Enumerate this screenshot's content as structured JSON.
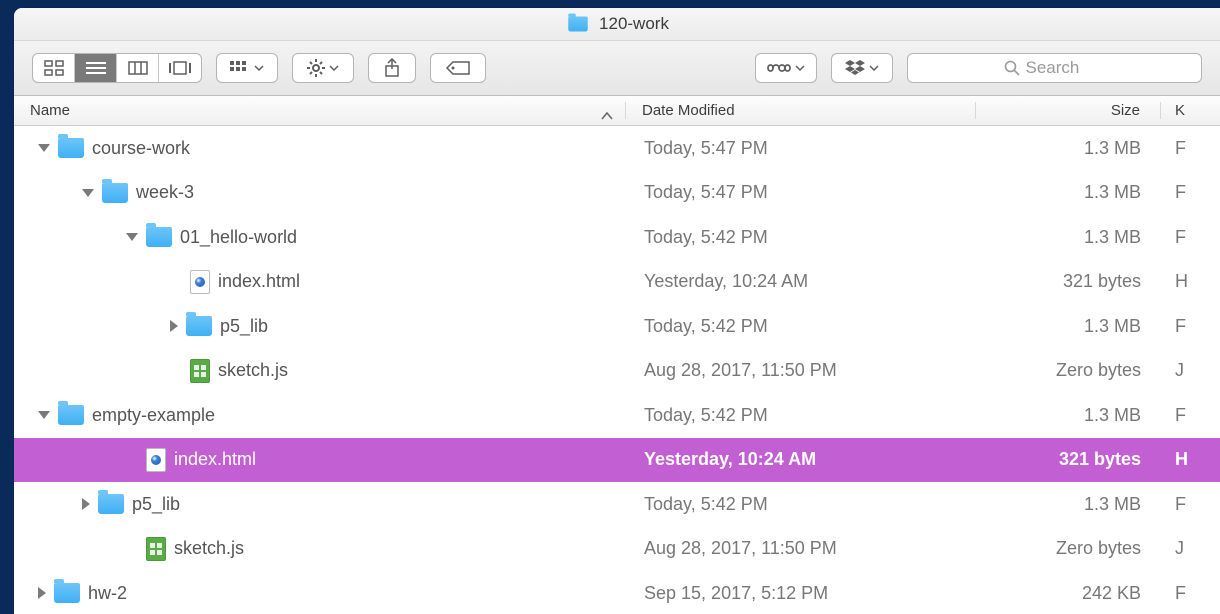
{
  "window": {
    "title": "120-work"
  },
  "search": {
    "placeholder": "Search"
  },
  "columns": {
    "name": "Name",
    "date": "Date Modified",
    "size": "Size",
    "kind": "K"
  },
  "rows": [
    {
      "indent": 0,
      "disc": "open",
      "icon": "folder",
      "name": "course-work",
      "date": "Today, 5:47 PM",
      "size": "1.3 MB",
      "kind": "F",
      "selected": false
    },
    {
      "indent": 1,
      "disc": "open",
      "icon": "folder",
      "name": "week-3",
      "date": "Today, 5:47 PM",
      "size": "1.3 MB",
      "kind": "F",
      "selected": false
    },
    {
      "indent": 2,
      "disc": "open",
      "icon": "folder",
      "name": "01_hello-world",
      "date": "Today, 5:42 PM",
      "size": "1.3 MB",
      "kind": "F",
      "selected": false
    },
    {
      "indent": 3,
      "disc": "none",
      "icon": "html",
      "name": "index.html",
      "date": "Yesterday, 10:24 AM",
      "size": "321 bytes",
      "kind": "H",
      "selected": false
    },
    {
      "indent": 3,
      "disc": "closed",
      "icon": "folder",
      "name": "p5_lib",
      "date": "Today, 5:42 PM",
      "size": "1.3 MB",
      "kind": "F",
      "selected": false
    },
    {
      "indent": 3,
      "disc": "none",
      "icon": "js",
      "name": "sketch.js",
      "date": "Aug 28, 2017, 11:50 PM",
      "size": "Zero bytes",
      "kind": "J",
      "selected": false
    },
    {
      "indent": 0,
      "disc": "open",
      "icon": "folder",
      "name": "empty-example",
      "date": "Today, 5:42 PM",
      "size": "1.3 MB",
      "kind": "F",
      "selected": false
    },
    {
      "indent": 2,
      "disc": "none",
      "icon": "html",
      "name": "index.html",
      "date": "Yesterday, 10:24 AM",
      "size": "321 bytes",
      "kind": "H",
      "selected": true
    },
    {
      "indent": 1,
      "disc": "closed",
      "icon": "folder",
      "name": "p5_lib",
      "date": "Today, 5:42 PM",
      "size": "1.3 MB",
      "kind": "F",
      "selected": false
    },
    {
      "indent": 2,
      "disc": "none",
      "icon": "js",
      "name": "sketch.js",
      "date": "Aug 28, 2017, 11:50 PM",
      "size": "Zero bytes",
      "kind": "J",
      "selected": false
    },
    {
      "indent": 0,
      "disc": "closed",
      "icon": "folder",
      "name": "hw-2",
      "date": "Sep 15, 2017, 5:12 PM",
      "size": "242 KB",
      "kind": "F",
      "selected": false
    }
  ]
}
